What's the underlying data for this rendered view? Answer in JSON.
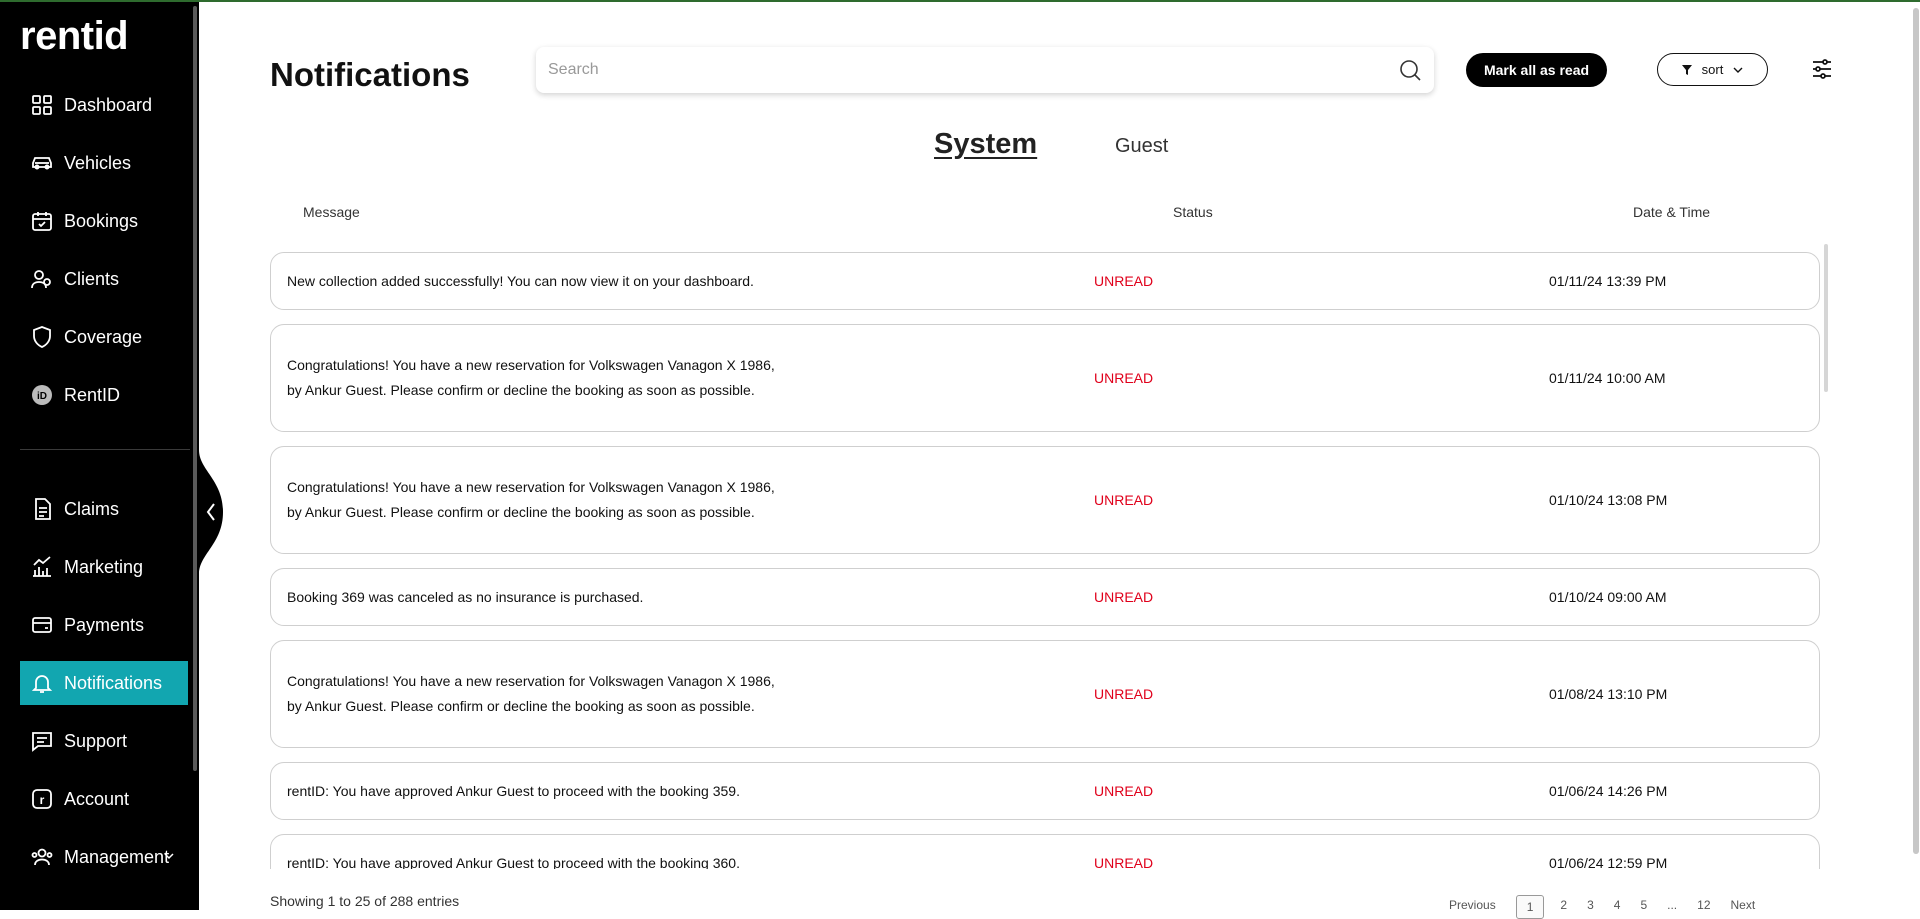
{
  "app": {
    "logo": "rentid"
  },
  "sidebar": {
    "items": [
      {
        "label": "Dashboard",
        "icon": "dashboard-grid-icon"
      },
      {
        "label": "Vehicles",
        "icon": "car-icon"
      },
      {
        "label": "Bookings",
        "icon": "calendar-check-icon"
      },
      {
        "label": "Clients",
        "icon": "users-icon"
      },
      {
        "label": "Coverage",
        "icon": "shield-icon"
      },
      {
        "label": "RentID",
        "icon": "rentid-badge-icon"
      },
      {
        "label": "Claims",
        "icon": "document-icon"
      },
      {
        "label": "Marketing",
        "icon": "chart-growth-icon"
      },
      {
        "label": "Payments",
        "icon": "wallet-icon"
      },
      {
        "label": "Notifications",
        "icon": "bell-icon",
        "active": true
      },
      {
        "label": "Support",
        "icon": "chat-icon"
      },
      {
        "label": "Account",
        "icon": "account-r-icon"
      },
      {
        "label": "Management",
        "icon": "team-icon",
        "expandable": true
      }
    ]
  },
  "header": {
    "title": "Notifications",
    "search_placeholder": "Search",
    "mark_all_label": "Mark all as read",
    "sort_label": "sort"
  },
  "tabs": [
    {
      "label": "System",
      "active": true
    },
    {
      "label": "Guest",
      "active": false
    }
  ],
  "table": {
    "columns": [
      "Message",
      "Status",
      "Date & Time"
    ],
    "rows": [
      {
        "message": "New collection added successfully! You can now view it on your dashboard.",
        "status": "UNREAD",
        "datetime": "01/11/24 13:39 PM"
      },
      {
        "message": "Congratulations! You have a new reservation for Volkswagen Vanagon X 1986, by Ankur Guest. Please confirm or decline the booking as soon as possible.",
        "status": "UNREAD",
        "datetime": "01/11/24 10:00 AM"
      },
      {
        "message": "Congratulations! You have a new reservation for Volkswagen Vanagon X 1986, by Ankur Guest. Please confirm or decline the booking as soon as possible.",
        "status": "UNREAD",
        "datetime": "01/10/24 13:08 PM"
      },
      {
        "message": "Booking 369 was canceled as no insurance is purchased.",
        "status": "UNREAD",
        "datetime": "01/10/24 09:00 AM"
      },
      {
        "message": "Congratulations! You have a new reservation for Volkswagen Vanagon X 1986, by Ankur Guest. Please confirm or decline the booking as soon as possible.",
        "status": "UNREAD",
        "datetime": "01/08/24 13:10 PM"
      },
      {
        "message": "rentID: You have approved Ankur Guest to proceed with the booking 359.",
        "status": "UNREAD",
        "datetime": "01/06/24 14:26 PM"
      },
      {
        "message": "rentID: You have approved Ankur Guest to proceed with the booking 360.",
        "status": "UNREAD",
        "datetime": "01/06/24 12:59 PM"
      }
    ]
  },
  "footer": {
    "info": "Showing 1 to 25 of 288 entries",
    "pager": {
      "previous": "Previous",
      "pages": [
        "1",
        "2",
        "3",
        "4",
        "5"
      ],
      "ellipsis": "...",
      "last": "12",
      "next": "Next"
    }
  },
  "colors": {
    "accent": "#12a6b0",
    "unread": "#e0001b",
    "sidebar_bg": "#000000"
  }
}
